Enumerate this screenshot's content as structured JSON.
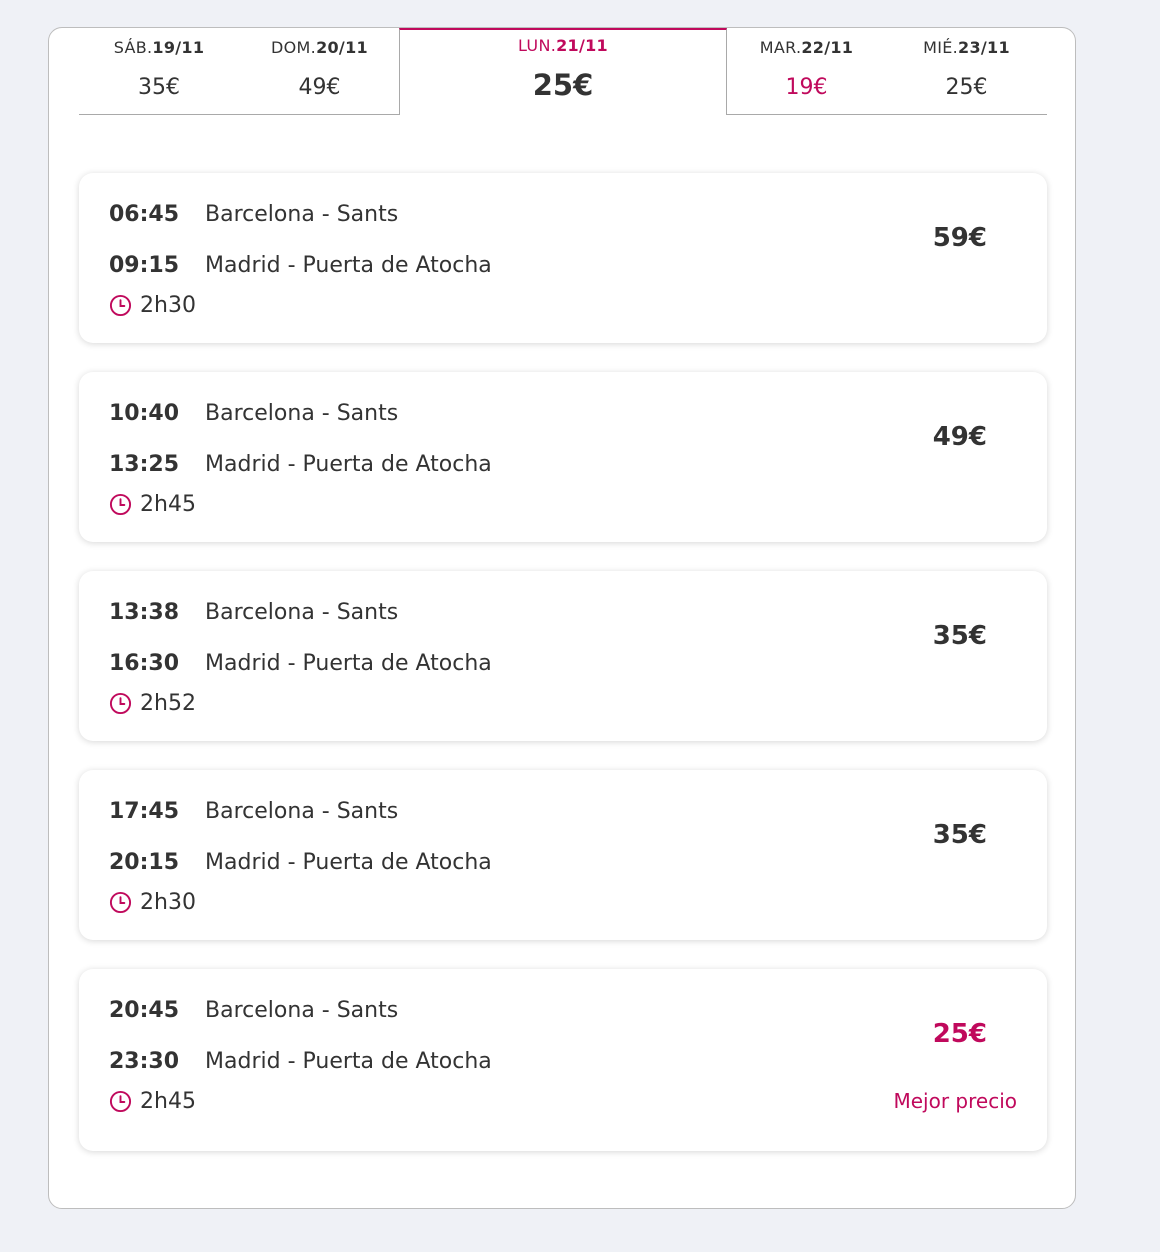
{
  "date_tabs": [
    {
      "day": "SÁB.",
      "date": "19/11",
      "price": "35€"
    },
    {
      "day": "DOM.",
      "date": "20/11",
      "price": "49€"
    },
    {
      "day": "LUN.",
      "date": "21/11",
      "price": "25€",
      "selected": true
    },
    {
      "day": "MAR.",
      "date": "22/11",
      "price": "19€",
      "cheapest": true
    },
    {
      "day": "MIÉ.",
      "date": "23/11",
      "price": "25€"
    }
  ],
  "trips": [
    {
      "dep_time": "06:45",
      "dep_station": "Barcelona - Sants",
      "arr_time": "09:15",
      "arr_station": "Madrid - Puerta de Atocha",
      "duration": "2h30",
      "price": "59€"
    },
    {
      "dep_time": "10:40",
      "dep_station": "Barcelona - Sants",
      "arr_time": "13:25",
      "arr_station": "Madrid - Puerta de Atocha",
      "duration": "2h45",
      "price": "49€"
    },
    {
      "dep_time": "13:38",
      "dep_station": "Barcelona - Sants",
      "arr_time": "16:30",
      "arr_station": "Madrid - Puerta de Atocha",
      "duration": "2h52",
      "price": "35€"
    },
    {
      "dep_time": "17:45",
      "dep_station": "Barcelona - Sants",
      "arr_time": "20:15",
      "arr_station": "Madrid - Puerta de Atocha",
      "duration": "2h30",
      "price": "35€"
    },
    {
      "dep_time": "20:45",
      "dep_station": "Barcelona - Sants",
      "arr_time": "23:30",
      "arr_station": "Madrid - Puerta de Atocha",
      "duration": "2h45",
      "price": "25€",
      "best_label": "Mejor precio"
    }
  ],
  "colors": {
    "accent": "#c0095c",
    "text": "#333333",
    "background": "#eff1f6"
  },
  "icons": {
    "duration": "clock-icon"
  }
}
